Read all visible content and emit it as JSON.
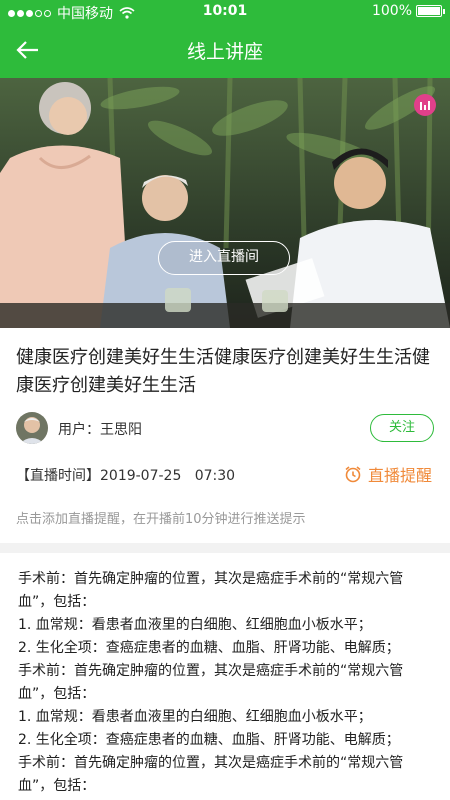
{
  "status_bar": {
    "carrier": "中国移动",
    "time": "10:01",
    "battery": "100%",
    "battery_level": 1.0
  },
  "nav": {
    "title": "线上讲座",
    "back_icon": "back-arrow-icon"
  },
  "hero": {
    "enter_button": "进入直播间",
    "live_icon": "live-bars-icon",
    "badge_color": "#e0408a"
  },
  "lecture": {
    "headline": "健康医疗创建美好生生活健康医疗创建美好生生活健康医疗创建美好生生活",
    "user_label": "用户：",
    "user_name": "王思阳",
    "follow_label": "关注",
    "time_label": "【直播时间】",
    "time_value": "2019-07-25   07:30",
    "remind_label": "直播提醒",
    "remind_icon": "alarm-clock-icon",
    "hint": "点击添加直播提醒，在开播前10分钟进行推送提示"
  },
  "body_lines": [
    "手术前：首先确定肿瘤的位置，其次是癌症手术前的“常规六管",
    "血”，包括：",
    "1. 血常规：看患者血液里的白细胞、红细胞血小板水平；",
    "2. 生化全项：查癌症患者的血糖、血脂、肝肾功能、电解质；",
    "手术前：首先确定肿瘤的位置，其次是癌症手术前的“常规六管",
    "血”，包括：",
    "1. 血常规：看患者血液里的白细胞、红细胞血小板水平；",
    "2. 生化全项：查癌症患者的血糖、血脂、肝肾功能、电解质；",
    "手术前：首先确定肿瘤的位置，其次是癌症手术前的“常规六管",
    "血”，包括："
  ],
  "colors": {
    "primary": "#2ebb3b",
    "accent": "#f08a3a"
  }
}
